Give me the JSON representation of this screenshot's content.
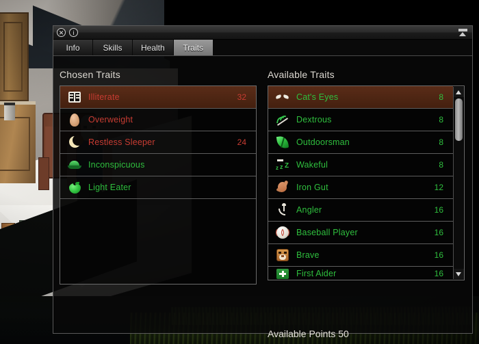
{
  "window": {
    "title_icons": [
      "close-icon",
      "info-icon"
    ],
    "close_label": "✕",
    "info_label": "i",
    "collapse_label": "collapse-panel"
  },
  "tabs": [
    {
      "label": "Info",
      "active": false
    },
    {
      "label": "Skills",
      "active": false
    },
    {
      "label": "Health",
      "active": false
    },
    {
      "label": "Traits",
      "active": true
    }
  ],
  "chosen": {
    "heading": "Chosen Traits",
    "items": [
      {
        "name": "Illiterate",
        "cost": "32",
        "icon": "book-icon",
        "polarity": "negative",
        "selected": true
      },
      {
        "name": "Overweight",
        "cost": "",
        "icon": "egg-icon",
        "polarity": "negative",
        "selected": false
      },
      {
        "name": "Restless Sleeper",
        "cost": "24",
        "icon": "moon-icon",
        "polarity": "negative",
        "selected": false
      },
      {
        "name": "Inconspicuous",
        "cost": "",
        "icon": "cap-icon",
        "polarity": "positive",
        "selected": false
      },
      {
        "name": "Light Eater",
        "cost": "",
        "icon": "apple-icon",
        "polarity": "positive",
        "selected": false
      }
    ]
  },
  "available": {
    "heading": "Available Traits",
    "items": [
      {
        "name": "Cat's Eyes",
        "cost": "8",
        "icon": "cat-eyes-icon",
        "polarity": "positive",
        "selected": true
      },
      {
        "name": "Dextrous",
        "cost": "8",
        "icon": "hand-icon",
        "polarity": "positive",
        "selected": false
      },
      {
        "name": "Outdoorsman",
        "cost": "8",
        "icon": "leaf-icon",
        "polarity": "positive",
        "selected": false
      },
      {
        "name": "Wakeful",
        "cost": "8",
        "icon": "zzz-icon",
        "polarity": "positive",
        "selected": false
      },
      {
        "name": "Iron Gut",
        "cost": "12",
        "icon": "stomach-icon",
        "polarity": "positive",
        "selected": false
      },
      {
        "name": "Angler",
        "cost": "16",
        "icon": "fish-hook-icon",
        "polarity": "positive",
        "selected": false
      },
      {
        "name": "Baseball Player",
        "cost": "16",
        "icon": "baseball-icon",
        "polarity": "positive",
        "selected": false
      },
      {
        "name": "Brave",
        "cost": "16",
        "icon": "lion-icon",
        "polarity": "positive",
        "selected": false
      },
      {
        "name": "First Aider",
        "cost": "16",
        "icon": "medical-cross-icon",
        "polarity": "positive",
        "selected": false
      }
    ],
    "scrollbar": {
      "up_arrow": "scroll-up",
      "down_arrow": "scroll-down"
    }
  },
  "footer": {
    "available_points": "Available Points 50"
  },
  "colors": {
    "negative_text": "#c83c32",
    "positive_text": "#2fbf3e",
    "selected_row": "#4a2414",
    "heading_text": "#ddd9d2",
    "panel_border": "#6b6b6b"
  }
}
